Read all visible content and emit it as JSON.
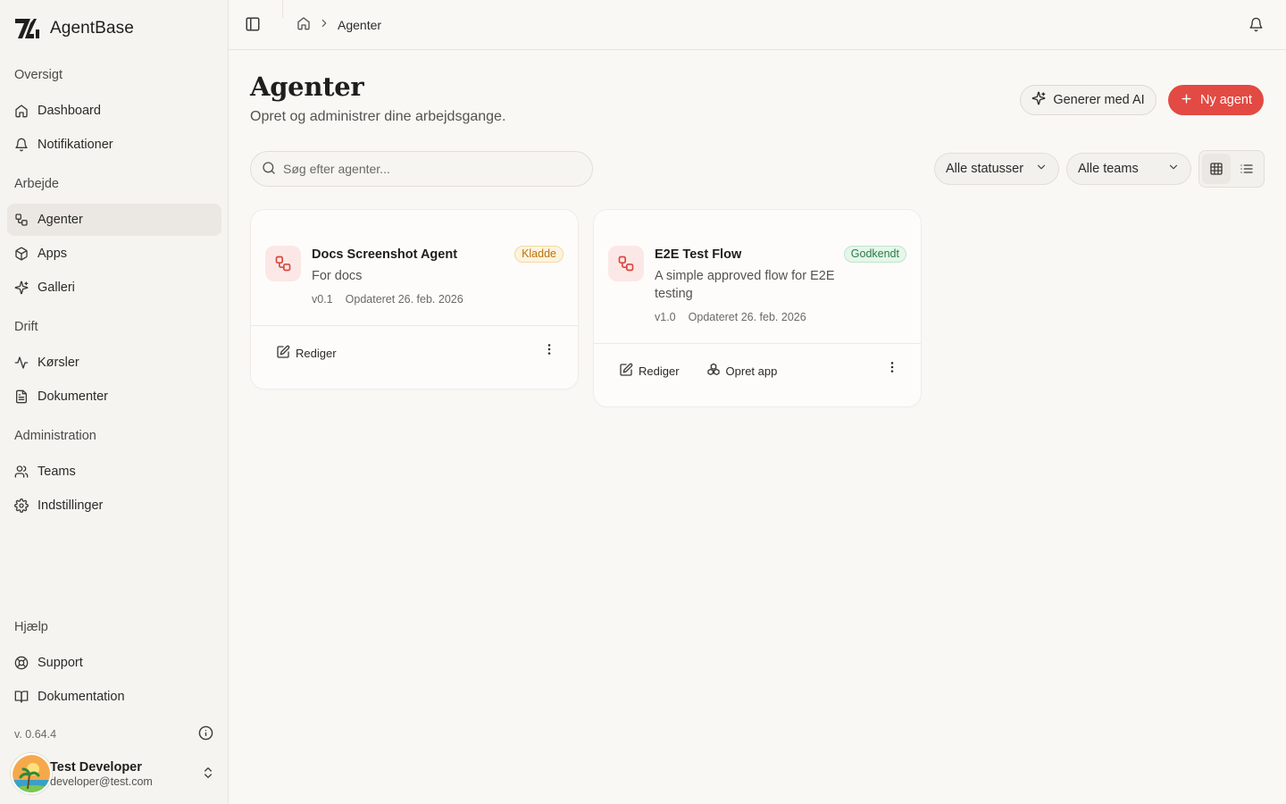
{
  "brand": {
    "name": "AgentBase"
  },
  "sidebar": {
    "groups": [
      {
        "title": "Oversigt",
        "items": [
          {
            "label": "Dashboard",
            "icon": "home-icon"
          },
          {
            "label": "Notifikationer",
            "icon": "bell-icon"
          }
        ]
      },
      {
        "title": "Arbejde",
        "items": [
          {
            "label": "Agenter",
            "icon": "workflow-icon",
            "active": true
          },
          {
            "label": "Apps",
            "icon": "box-icon"
          },
          {
            "label": "Galleri",
            "icon": "sparkles-icon"
          }
        ]
      },
      {
        "title": "Drift",
        "items": [
          {
            "label": "Kørsler",
            "icon": "activity-icon"
          },
          {
            "label": "Dokumenter",
            "icon": "file-text-icon"
          }
        ]
      },
      {
        "title": "Administration",
        "items": [
          {
            "label": "Teams",
            "icon": "users-icon"
          },
          {
            "label": "Indstillinger",
            "icon": "settings-icon"
          }
        ]
      },
      {
        "title": "Hjælp",
        "items": [
          {
            "label": "Support",
            "icon": "life-buoy-icon"
          },
          {
            "label": "Dokumentation",
            "icon": "book-open-icon"
          }
        ]
      }
    ],
    "version": "v. 0.64.4",
    "user": {
      "name": "Test Developer",
      "email": "developer@test.com"
    }
  },
  "topbar": {
    "breadcrumb_current": "Agenter"
  },
  "page": {
    "title": "Agenter",
    "subtitle": "Opret og administrer dine arbejdsgange.",
    "btn_ai": "Generer med AI",
    "btn_new": "Ny agent",
    "search_placeholder": "Søg efter agenter...",
    "filter_status": "Alle statusser",
    "filter_teams": "Alle teams"
  },
  "cards": [
    {
      "title": "Docs Screenshot Agent",
      "badge": "Kladde",
      "badge_type": "draft",
      "description": "For docs",
      "version": "v0.1",
      "updated": "Opdateret 26. feb. 2026",
      "actions": [
        "Rediger"
      ]
    },
    {
      "title": "E2E Test Flow",
      "badge": "Godkendt",
      "badge_type": "approved",
      "description": "A simple approved flow for E2E testing",
      "version": "v1.0",
      "updated": "Opdateret 26. feb. 2026",
      "actions": [
        "Rediger",
        "Opret app"
      ]
    }
  ],
  "colors": {
    "accent": "#e24a43",
    "draft": "#b9740c",
    "approved": "#2b7a45"
  }
}
